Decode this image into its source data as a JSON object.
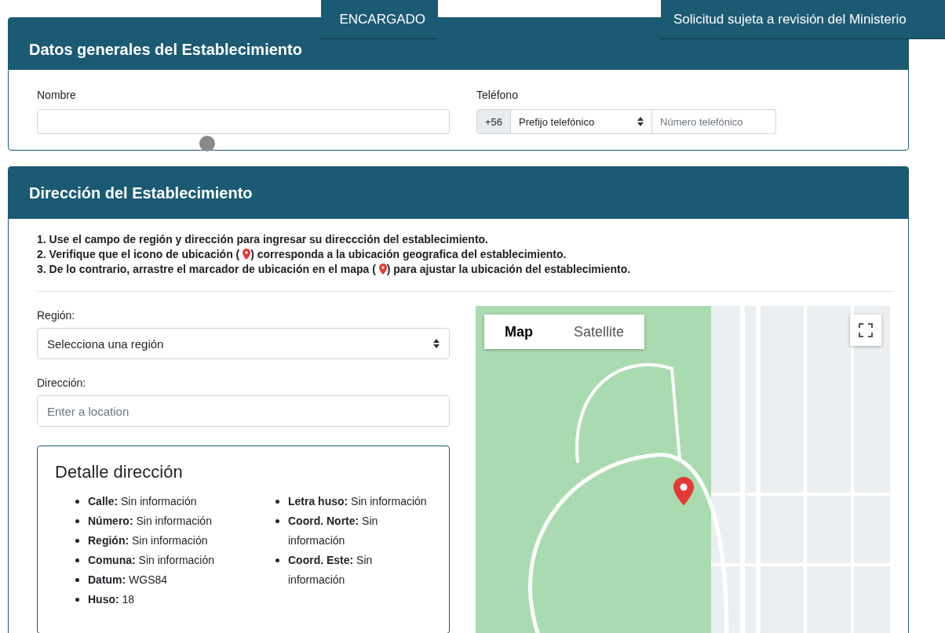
{
  "overlay_tabs": [
    {
      "label": "ENCARGADO"
    },
    {
      "label": "Solicitud sujeta a revisión del Ministerio"
    }
  ],
  "general": {
    "title": "Datos generales del Establecimiento",
    "name_label": "Nombre",
    "phone_label": "Teléfono",
    "phone_prefix": "+56",
    "prefix_select": "Prefijo telefónico",
    "phone_placeholder": "Número telefónico"
  },
  "address": {
    "title": "Dirección del Establecimiento",
    "instructions": [
      {
        "kind": "plain",
        "text": "1. Use el campo de región y dirección para ingresar su direccción del establecimiento."
      },
      {
        "kind": "with-icon",
        "text": "2. Verifique que el icono de ubicación (",
        "after": ") corresponda a la ubicación geografica del establecimiento."
      },
      {
        "kind": "with-icon",
        "text": "3. De lo contrario, arrastre el marcador de ubicación en el mapa (",
        "after": ") para ajustar la ubicación del establecimiento."
      }
    ],
    "region_label": "Región:",
    "region_select": "Selecciona una región",
    "address_label": "Dirección:",
    "address_placeholder": "Enter a location",
    "detail": {
      "title": "Detalle dirección",
      "columns": [
        [
          "**Calle:** Sin información",
          "**Número:** Sin información",
          "**Región:** Sin información",
          "**Comuna:** Sin información",
          "**Datum:** WGS84",
          "**Huso:** 18"
        ],
        [
          "**Letra huso:** Sin información",
          "**Coord. Norte:** Sin información",
          "**Coord. Este:** Sin información"
        ]
      ]
    },
    "map": {
      "types": [
        {
          "label": "Map",
          "selected": true
        },
        {
          "label": "Satellite",
          "selected": false
        }
      ]
    }
  }
}
